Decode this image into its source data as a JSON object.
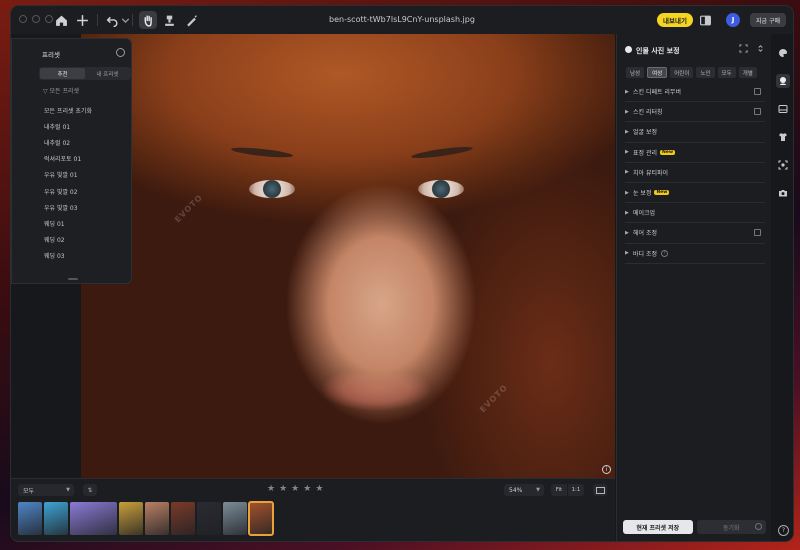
{
  "window": {
    "filename": "ben-scott-tWb7lsL9CnY-unsplash.jpg",
    "export_label": "내보내기",
    "avatar_initial": "J",
    "buy_label": "지금 구매"
  },
  "preset_panel": {
    "title": "프리셋",
    "tabs": [
      "추천",
      "내 프리셋"
    ],
    "filter_label": "모든 프리셋",
    "items": [
      "모든 프리셋 초기화",
      "내추럴 01",
      "내추럴 02",
      "럭셔리포토 01",
      "우유 빛깔 01",
      "우유 빛깔 02",
      "우유 빛깔 03",
      "웨딩 01",
      "웨딩 02",
      "웨딩 03"
    ]
  },
  "right_panel": {
    "title": "인물 사진 보정",
    "chips": [
      "남성",
      "여성",
      "어린이",
      "노인",
      "모두",
      "개별"
    ],
    "active_chip": "여성",
    "rows": [
      {
        "label": "스킨 디페트 리무버",
        "new": "",
        "edit": true
      },
      {
        "label": "스킨 리터칭",
        "new": "",
        "edit": true
      },
      {
        "label": "얼굴 보정",
        "new": "",
        "edit": false
      },
      {
        "label": "표정 관리",
        "new": "New",
        "edit": false
      },
      {
        "label": "치아 뷰티파이",
        "new": "",
        "edit": false
      },
      {
        "label": "눈 보정",
        "new": "New",
        "edit": false
      },
      {
        "label": "메이크업",
        "new": "",
        "edit": false
      },
      {
        "label": "헤어 조정",
        "new": "",
        "edit": true
      },
      {
        "label": "바디 조정",
        "new": "",
        "edit": false,
        "help": "?"
      }
    ],
    "save_label": "현재 프리셋 저장",
    "sync_label": "동기화"
  },
  "filmstrip": {
    "filter_value": "모두",
    "sort_icon": "⇅",
    "zoom_value": "54%",
    "fit_label": "Fit",
    "one_to_one_label": "1:1",
    "star_rating": 0,
    "stars": [
      "★",
      "★",
      "★",
      "★",
      "★"
    ],
    "thumb_colors": [
      "#4e86c6",
      "#3fa3d4",
      "#8a7bd6",
      "#c9a03a",
      "#b98063",
      "#7a3a2a",
      "#2a2b30",
      "#7a8c98",
      "#a4532b"
    ]
  },
  "canvas": {
    "info_icon": "i",
    "watermark": "EVOTO"
  }
}
